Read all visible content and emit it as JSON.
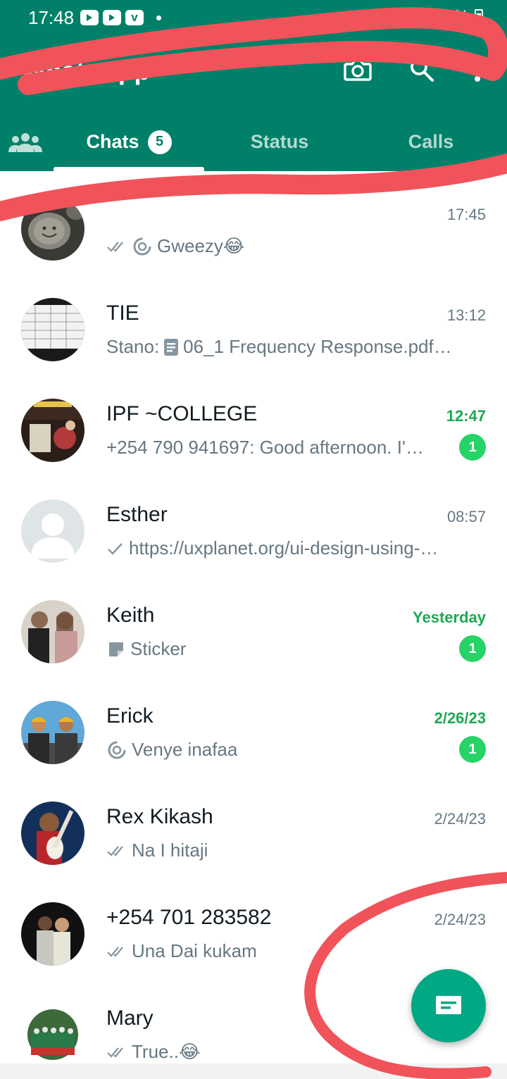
{
  "status_bar": {
    "time": "17:48",
    "battery_text": "3%"
  },
  "app": {
    "title": "WhatsApp",
    "icons": [
      "camera-icon",
      "search-icon",
      "more-vert-icon"
    ]
  },
  "tabs": {
    "community_icon": "community-icon",
    "items": [
      {
        "label": "Chats",
        "badge": "5",
        "active": true
      },
      {
        "label": "Status",
        "active": false
      },
      {
        "label": "Calls",
        "active": false
      }
    ]
  },
  "chats": [
    {
      "name": "",
      "time": "17:45",
      "preview": "Gweezy😂",
      "icon": "double-check-icon,community-sync-icon",
      "unread": null
    },
    {
      "name": "TIE",
      "time": "13:12",
      "sender": "Stano:",
      "preview": "06_1 Frequency Response.pdf…",
      "icon": "document-icon",
      "unread": null
    },
    {
      "name": "IPF ~COLLEGE",
      "time": "12:47",
      "preview": "+254 790 941697: Good afternoon. I'…",
      "unread": "1",
      "time_highlight": true
    },
    {
      "name": "Esther",
      "time": "08:57",
      "preview": "https://uxplanet.org/ui-design-using-…",
      "icon": "single-check-icon",
      "unread": null
    },
    {
      "name": "Keith",
      "time": "Yesterday",
      "preview": "Sticker",
      "icon": "sticker-icon",
      "unread": "1",
      "time_highlight": true
    },
    {
      "name": "Erick",
      "time": "2/26/23",
      "preview": "Venye inafaa",
      "icon": "community-sync-icon",
      "unread": "1",
      "time_highlight": true
    },
    {
      "name": "Rex Kikash",
      "time": "2/24/23",
      "preview": "Na I hitaji",
      "icon": "double-check-icon",
      "unread": null
    },
    {
      "name": "+254 701 283582",
      "time": "2/24/23",
      "preview": "Una Dai kukam",
      "icon": "double-check-icon",
      "unread": null
    },
    {
      "name": "Mary",
      "time": "",
      "preview": "True..😂",
      "icon": "double-check-icon",
      "unread": null
    }
  ],
  "fab": {
    "icon": "new-chat-icon"
  },
  "colors": {
    "header": "#008069",
    "fab": "#00a884",
    "unread": "#25d366",
    "highlight_time": "#1fa855",
    "secondary_text": "#667781",
    "annotation_scribble": "#f0535a"
  }
}
